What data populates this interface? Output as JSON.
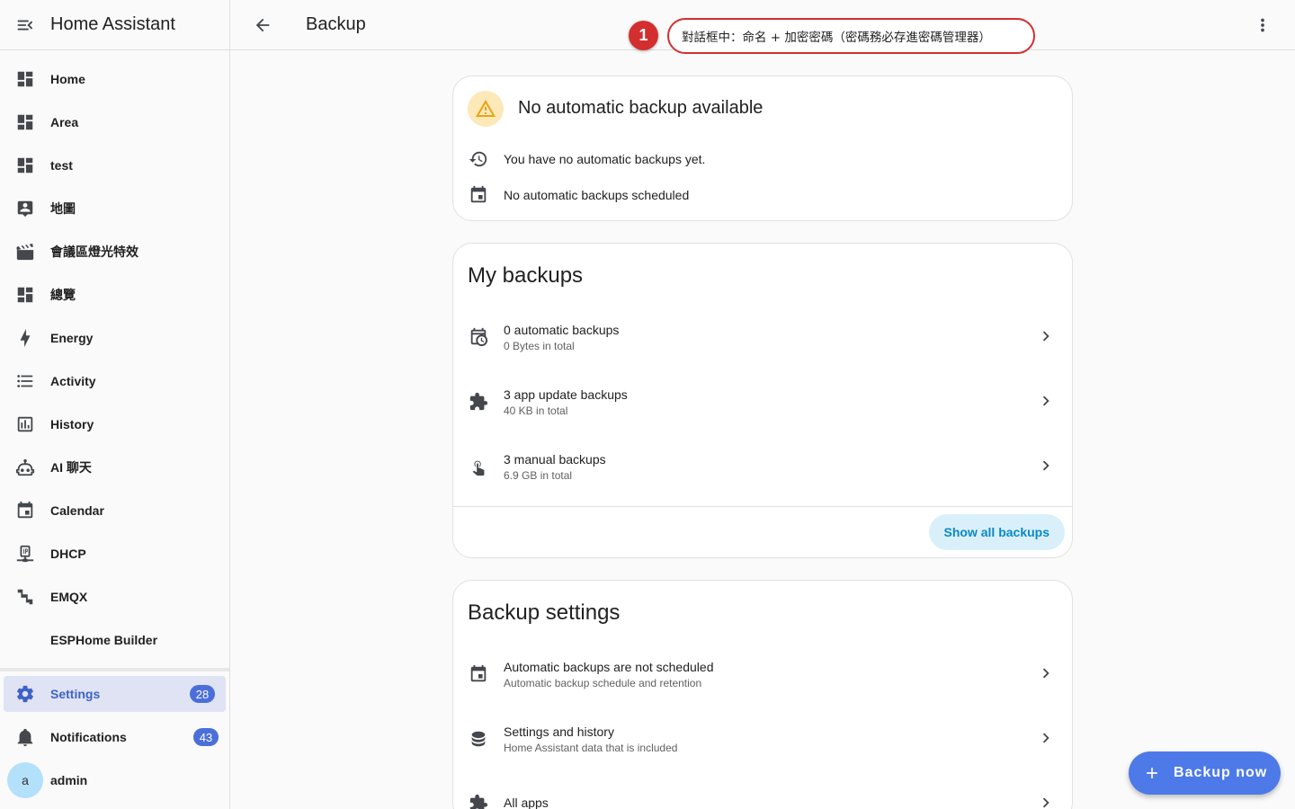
{
  "sidebar": {
    "app_title": "Home Assistant",
    "items": [
      {
        "label": "Home",
        "icon": "dashboard-icon"
      },
      {
        "label": "Area",
        "icon": "dashboard-icon"
      },
      {
        "label": "test",
        "icon": "dashboard-icon"
      },
      {
        "label": "地圖",
        "icon": "map-account-icon"
      },
      {
        "label": "會議區燈光特效",
        "icon": "movie-open-icon"
      },
      {
        "label": "總覽",
        "icon": "dashboard-icon"
      },
      {
        "label": "Energy",
        "icon": "lightning-bolt-icon"
      },
      {
        "label": "Activity",
        "icon": "format-list-bulleted-icon"
      },
      {
        "label": "History",
        "icon": "chart-box-icon"
      },
      {
        "label": "AI 聊天",
        "icon": "robot-icon"
      },
      {
        "label": "Calendar",
        "icon": "calendar-icon"
      },
      {
        "label": "DHCP",
        "icon": "ip-network-icon"
      },
      {
        "label": "EMQX",
        "icon": "stairs-icon"
      },
      {
        "label": "ESPHome Builder",
        "icon": ""
      }
    ],
    "settings": {
      "label": "Settings",
      "badge": "28"
    },
    "notifications": {
      "label": "Notifications",
      "badge": "43"
    },
    "user": {
      "label": "admin",
      "avatar_letter": "a"
    }
  },
  "topbar": {
    "title": "Backup"
  },
  "annotation": {
    "number": "1",
    "text": "對話框中：命名 + 加密密碼（密碼務必存進密碼管理器）"
  },
  "status_card": {
    "title": "No automatic backup available",
    "line1": "You have no automatic backups yet.",
    "line2": "No automatic backups scheduled"
  },
  "my_backups": {
    "title": "My backups",
    "rows": [
      {
        "primary": "0 automatic backups",
        "secondary": "0 Bytes in total"
      },
      {
        "primary": "3 app update backups",
        "secondary": "40 KB in total"
      },
      {
        "primary": "3 manual backups",
        "secondary": "6.9 GB in total"
      }
    ],
    "show_all_label": "Show all backups"
  },
  "backup_settings": {
    "title": "Backup settings",
    "rows": [
      {
        "primary": "Automatic backups are not scheduled",
        "secondary": "Automatic backup schedule and retention"
      },
      {
        "primary": "Settings and history",
        "secondary": "Home Assistant data that is included"
      },
      {
        "primary": "All apps",
        "secondary": ""
      }
    ]
  },
  "fab": {
    "label": "Backup now"
  },
  "colors": {
    "accent": "#4d7ae8",
    "annotation_red": "#d32f2f",
    "warning_bg": "#fde8b8",
    "active_bg": "#dfe3f4"
  }
}
